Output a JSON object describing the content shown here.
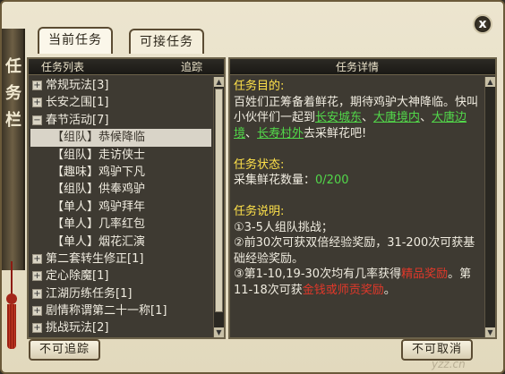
{
  "window": {
    "tabs": [
      {
        "label": "当前任务",
        "active": true
      },
      {
        "label": "可接任务",
        "active": false
      }
    ],
    "close_label": "x",
    "side_glyphs": [
      "任",
      "务",
      "栏"
    ]
  },
  "list_panel": {
    "header": "任务列表",
    "track_label": "追踪",
    "items": [
      {
        "label": "常规玩法[3]",
        "type": "group",
        "expanded": false
      },
      {
        "label": "长安之围[1]",
        "type": "group",
        "expanded": false
      },
      {
        "label": "春节活动[7]",
        "type": "group",
        "expanded": true
      },
      {
        "label": "【组队】恭候降临",
        "type": "sub",
        "selected": true
      },
      {
        "label": "【组队】走访侠士",
        "type": "sub"
      },
      {
        "label": "【趣味】鸡驴下凡",
        "type": "sub"
      },
      {
        "label": "【组队】供奉鸡驴",
        "type": "sub"
      },
      {
        "label": "【单人】鸡驴拜年",
        "type": "sub"
      },
      {
        "label": "【单人】几率红包",
        "type": "sub"
      },
      {
        "label": "【单人】烟花汇演",
        "type": "sub"
      },
      {
        "label": "第二套转生修正[1]",
        "type": "group",
        "expanded": false
      },
      {
        "label": "定心除魔[1]",
        "type": "group",
        "expanded": false
      },
      {
        "label": "江湖历练任务[1]",
        "type": "group",
        "expanded": false
      },
      {
        "label": "剧情称谓第二十一称[1]",
        "type": "group",
        "expanded": false
      },
      {
        "label": "挑战玩法[2]",
        "type": "group",
        "expanded": false
      }
    ]
  },
  "detail_panel": {
    "header": "任务详情",
    "goal_title": "任务目的:",
    "goal_text_1": "百姓们正筹备着鲜花，期待鸡驴大神降临。快叫小伙伴们一起到",
    "link_1": "长安城东",
    "sep_1": "、",
    "link_2": "大唐境内",
    "sep_2": "、",
    "link_3": "大唐边境",
    "sep_3": "、",
    "link_4": "长寿村外",
    "goal_text_2": "去采鲜花吧!",
    "status_title": "任务状态:",
    "status_label": "采集鲜花数量：",
    "status_value": "0/200",
    "desc_title": "任务说明:",
    "desc_1": "①3-5人组队挑战；",
    "desc_2": "②前30次可获双倍经验奖励，31-200次可获基础经验奖励。",
    "desc_3a": "③第1-10,19-30次均有几率获得",
    "desc_3b": "精品奖励",
    "desc_3c": "。第11-18次可获",
    "desc_3d": "金钱或师贡奖励",
    "desc_3e": "。"
  },
  "buttons": {
    "untrack": "不可追踪",
    "cancel": "不可取消"
  },
  "watermark": "yzz.cn",
  "colors": {
    "highlight_yellow": "#ffe24a",
    "link_green": "#52d84a",
    "reward_red": "#e2382a"
  }
}
